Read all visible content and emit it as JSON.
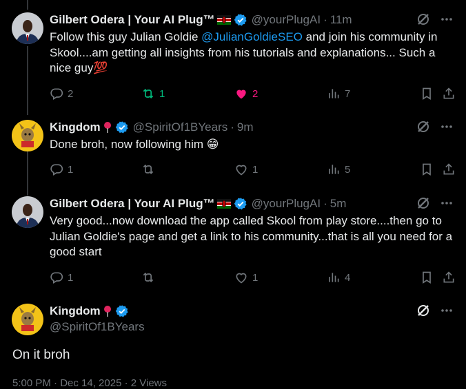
{
  "tweets": [
    {
      "name": "Gilbert Odera | Your AI Plug™",
      "handle": "@yourPlugAI",
      "time": "11m",
      "text_before": "Follow this guy Julian Goldie ",
      "mention": "@JulianGoldieSEO",
      "text_after": " and join his community in Skool....am getting all insights from his tutorials and explanations... Such a nice guy💯",
      "replies": "2",
      "reposts": "1",
      "likes": "2",
      "views": "7"
    },
    {
      "name": "Kingdom",
      "handle": "@SpiritOf1BYears",
      "time": "9m",
      "text": "Done broh, now following him 😁",
      "replies": "1",
      "reposts": "",
      "likes": "1",
      "views": "5"
    },
    {
      "name": "Gilbert Odera | Your AI Plug™",
      "handle": "@yourPlugAI",
      "time": "5m",
      "text": "Very good...now download the app called Skool from play store....then go to Julian Goldie's page and get a link to his community...that is all you need for a good start",
      "replies": "1",
      "reposts": "",
      "likes": "1",
      "views": "4"
    }
  ],
  "main_tweet": {
    "name": "Kingdom",
    "handle": "@SpiritOf1BYears",
    "text": "On it broh",
    "footer": "5:00 PM · Dec 14, 2025 · 2 Views"
  },
  "colors": {
    "background": "#000000",
    "text": "#e7e9ea",
    "muted": "#71767b",
    "link": "#1d9bf0",
    "verified": "#1d9bf0",
    "repost_active": "#00ba7c",
    "like_active": "#f91880"
  },
  "icons": [
    "grok-icon",
    "more-icon",
    "reply-icon",
    "repost-icon",
    "like-icon",
    "views-icon",
    "bookmark-icon",
    "share-icon",
    "verified-badge-icon",
    "kenya-flag-icon",
    "location-pin-icon"
  ]
}
